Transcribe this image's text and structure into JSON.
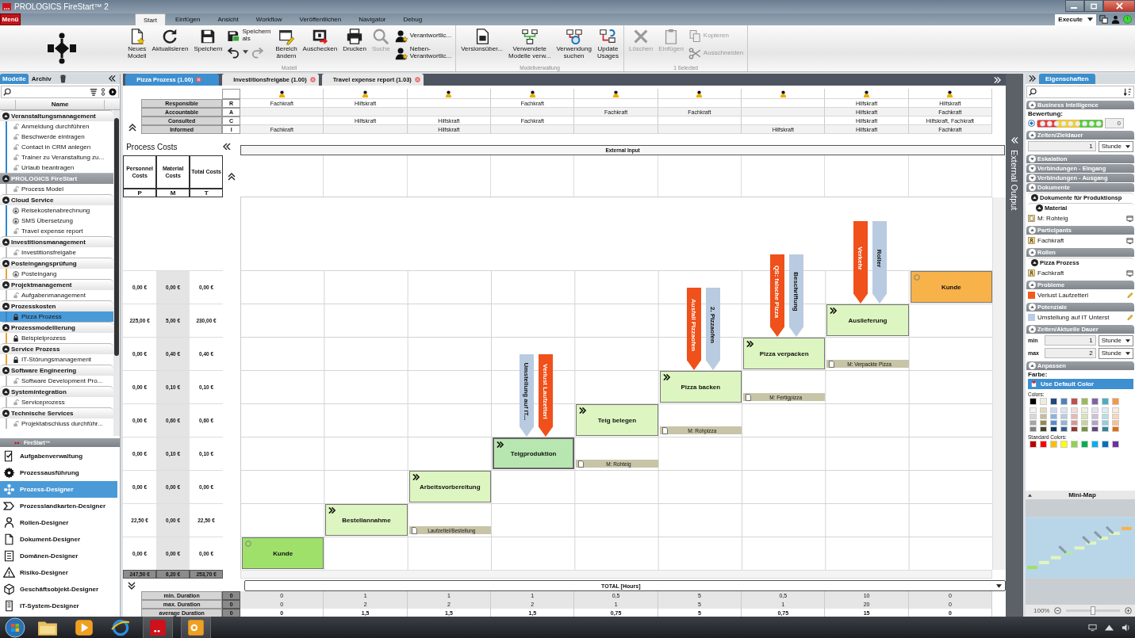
{
  "app": {
    "title": "PROLOGICS FireStart™ 2",
    "menu": "Menü",
    "mode": "Execute"
  },
  "ribbon": {
    "tabs": [
      {
        "label": "Start",
        "selected": true
      },
      {
        "label": "Einfügen",
        "selected": false
      },
      {
        "label": "Ansicht",
        "selected": false
      },
      {
        "label": "Workflow",
        "selected": false
      },
      {
        "label": "Veröffentlichen",
        "selected": false
      },
      {
        "label": "Navigator",
        "selected": false
      },
      {
        "label": "Debug",
        "selected": false
      }
    ],
    "groups": [
      {
        "label": "Modell",
        "items": [
          {
            "kind": "large",
            "label": "Neues\nModell",
            "disabled": false
          },
          {
            "kind": "large",
            "label": "Aktualisieren",
            "disabled": false
          },
          {
            "kind": "large",
            "label": "Speichern",
            "disabled": false
          },
          {
            "kind": "stack",
            "items": [
              {
                "kind": "small",
                "label": "Speichern\nals",
                "disabled": false
              },
              {
                "kind": "history",
                "disabled": false
              }
            ]
          },
          {
            "kind": "large",
            "label": "Bereich\nändern",
            "disabled": false
          },
          {
            "kind": "large",
            "label": "Auschecken",
            "disabled": false
          },
          {
            "kind": "large",
            "label": "Drucken",
            "disabled": false
          },
          {
            "kind": "large",
            "label": "Suche",
            "disabled": true
          },
          {
            "kind": "stack",
            "items": [
              {
                "kind": "small",
                "label": "Verantwortlic...",
                "disabled": false
              },
              {
                "kind": "small",
                "label": "Neben-\nVerantwortlic...",
                "disabled": false
              }
            ]
          }
        ]
      },
      {
        "label": "Modellverwaltung",
        "items": [
          {
            "kind": "large",
            "label": "Versionsüber...",
            "disabled": false
          },
          {
            "kind": "large",
            "label": "Verwendete\nModelle verw...",
            "disabled": false
          },
          {
            "kind": "large",
            "label": "Verwendung\nsuchen",
            "disabled": false
          },
          {
            "kind": "large",
            "label": "Update\nUsages",
            "disabled": false
          }
        ]
      },
      {
        "label": "1 Selected",
        "items": [
          {
            "kind": "large",
            "label": "Löschen",
            "disabled": true
          },
          {
            "kind": "large",
            "label": "Einfügen",
            "disabled": true
          },
          {
            "kind": "stack",
            "items": [
              {
                "kind": "small",
                "label": "Kopieren",
                "disabled": true
              },
              {
                "kind": "small",
                "label": "Ausschneiden",
                "disabled": true
              }
            ]
          }
        ]
      }
    ]
  },
  "models": {
    "tabs": [
      {
        "label": "Modelle",
        "selected": true
      },
      {
        "label": "Archiv",
        "selected": false
      }
    ],
    "column": "Name",
    "tree": [
      {
        "kind": "group",
        "label": "Veranstaltungsmanagement",
        "expanded": true,
        "children": [
          {
            "kind": "unlocked",
            "label": "Anmeldung durchführen",
            "color": "#2a8ad0",
            "selected": false
          },
          {
            "kind": "unlocked",
            "label": "Beschwerde eintragen",
            "color": "#2a8ad0",
            "selected": false
          },
          {
            "kind": "unlocked",
            "label": "Contact in CRM anlegen",
            "color": "#2a8ad0",
            "selected": false
          },
          {
            "kind": "unlocked",
            "label": "Trainer zu Veranstaltung zu...",
            "color": "#2a8ad0",
            "selected": false
          },
          {
            "kind": "unlocked",
            "label": "Urlaub beantragen",
            "color": "#2a8ad0",
            "selected": false
          }
        ]
      },
      {
        "kind": "root",
        "label": "PROLOGICS FireStart",
        "expanded": true,
        "children": [
          {
            "kind": "unlocked",
            "label": "Process Model",
            "color": "#c0c0c0",
            "selected": false
          }
        ]
      },
      {
        "kind": "group",
        "label": "Cloud Service",
        "expanded": true,
        "children": [
          {
            "kind": "checked-out",
            "label": "Reisekostenabrechnung",
            "color": "#2a8ad0",
            "selected": false
          },
          {
            "kind": "checked-out",
            "label": "SMS Übersetzung",
            "color": "#2a8ad0",
            "selected": false
          },
          {
            "kind": "unlocked",
            "label": "Travel expense report",
            "color": "#2a8ad0",
            "selected": false
          }
        ]
      },
      {
        "kind": "group",
        "label": "Investitionsmanagement",
        "expanded": true,
        "children": [
          {
            "kind": "unlocked",
            "label": "Investitionsfreigabe",
            "color": "#c0c0c0",
            "selected": false
          }
        ]
      },
      {
        "kind": "group",
        "label": "Posteingangsprüfung",
        "expanded": true,
        "children": [
          {
            "kind": "checked-out",
            "label": "Posteingang",
            "color": "#f0a030",
            "selected": false
          }
        ]
      },
      {
        "kind": "group",
        "label": "Projektmanagement",
        "expanded": true,
        "children": [
          {
            "kind": "unlocked",
            "label": "Aufgabenmanagement",
            "color": "#c0c0c0",
            "selected": false
          }
        ]
      },
      {
        "kind": "group",
        "label": "Prozesskosten",
        "expanded": true,
        "children": [
          {
            "kind": "locked",
            "label": "Pizza Prozess",
            "color": "#2a8ad0",
            "selected": true
          }
        ]
      },
      {
        "kind": "group",
        "label": "Prozessmodellierung",
        "expanded": true,
        "children": [
          {
            "kind": "locked",
            "label": "Beispielprozess",
            "color": "#f0a030",
            "selected": false
          }
        ]
      },
      {
        "kind": "group",
        "label": "Service Prozess",
        "expanded": true,
        "children": [
          {
            "kind": "locked",
            "label": "IT-Störungsmanagement",
            "color": "#f0a030",
            "selected": false
          }
        ]
      },
      {
        "kind": "group",
        "label": "Software Engineering",
        "expanded": true,
        "children": [
          {
            "kind": "unlocked",
            "label": "Software Development Pro...",
            "color": "#c0c0c0",
            "selected": false
          }
        ]
      },
      {
        "kind": "group",
        "label": "Systemintegration",
        "expanded": true,
        "children": [
          {
            "kind": "unlocked",
            "label": "Serviceprozess",
            "color": "#c0c0c0",
            "selected": false
          }
        ]
      },
      {
        "kind": "group",
        "label": "Technische Services",
        "expanded": true,
        "children": [
          {
            "kind": "unlocked",
            "label": "Projektabschluss durchführ...",
            "color": "#c0c0c0",
            "selected": false
          }
        ]
      }
    ],
    "nav_title": "FireStart™",
    "nav": [
      {
        "label": "Aufgabenverwaltung",
        "selected": false
      },
      {
        "label": "Prozessausführung",
        "selected": false
      },
      {
        "label": "Prozess-Designer",
        "selected": true
      },
      {
        "label": "Prozesslandkarten-Designer",
        "selected": false
      },
      {
        "label": "Rollen-Designer",
        "selected": false
      },
      {
        "label": "Dokument-Designer",
        "selected": false
      },
      {
        "label": "Domänen-Designer",
        "selected": false
      },
      {
        "label": "Risiko-Designer",
        "selected": false
      },
      {
        "label": "Geschäftsobjekt-Designer",
        "selected": false
      },
      {
        "label": "IT-System-Designer",
        "selected": false
      }
    ]
  },
  "center": {
    "doc_tabs": [
      {
        "label": "Pizza Prozess (1.00)",
        "selected": true
      },
      {
        "label": "Investitionsfreigabe (1.00)",
        "selected": false
      },
      {
        "label": "Travel expense report (1.03)",
        "selected": false
      }
    ],
    "raci_roles": [
      {
        "label": "Responsible",
        "letter": "R"
      },
      {
        "label": "Accountable",
        "letter": "A"
      },
      {
        "label": "Consulted",
        "letter": "C"
      },
      {
        "label": "Informed",
        "letter": "I"
      }
    ],
    "costs": {
      "title": "Process Costs",
      "columns": [
        {
          "label": "Personnel Costs",
          "letter": "P"
        },
        {
          "label": "Material Costs",
          "letter": "M"
        },
        {
          "label": "Total Costs",
          "letter": "T"
        }
      ],
      "totals": [
        "247,50 €",
        "6,20 €",
        "253,70 €"
      ]
    },
    "external_input": "External Input",
    "external_output": "External Output",
    "steps": [
      {
        "kind": "start",
        "label": "Kunde",
        "selected": false,
        "raci": {
          "responsible": "Fachkraft",
          "informed": "Fachkraft"
        },
        "costs": [
          "0,00 €",
          "0,00 €",
          "0,00 €"
        ],
        "durations": [
          "0",
          "0",
          "0"
        ]
      },
      {
        "kind": "task",
        "label": "Bestellannahme",
        "selected": false,
        "raci": {
          "responsible": "Hilfskraft",
          "consulted": "Hilfskraft"
        },
        "costs": [
          "22,50 €",
          "0,00 €",
          "22,50 €"
        ],
        "durations": [
          "1",
          "2",
          "1,5"
        ]
      },
      {
        "kind": "task",
        "label": "Arbeitsvorbereitung",
        "selected": false,
        "material": "Laufzettel/Bestellung",
        "raci": {
          "consulted": "Hilfskraft",
          "informed": "Hilfskraft"
        },
        "costs": [
          "0,00 €",
          "0,00 €",
          "0,00 €"
        ],
        "durations": [
          "1",
          "2",
          "1,5"
        ]
      },
      {
        "kind": "task",
        "label": "Teigproduktion",
        "selected": true,
        "raci": {
          "responsible": "Fachkraft",
          "consulted": "Fachkraft"
        },
        "costs": [
          "0,00 €",
          "0,10 €",
          "0,10 €"
        ],
        "durations": [
          "1",
          "2",
          "1,5"
        ],
        "flags": [
          {
            "kind": "potential",
            "label": "Umstellung auf IT..."
          },
          {
            "kind": "problem",
            "label": "Verlust Laufzetterl"
          }
        ]
      },
      {
        "kind": "task",
        "label": "Teig belegen",
        "selected": false,
        "material": "M: Rohteig",
        "raci": {
          "accountable": "Fachkraft"
        },
        "costs": [
          "0,00 €",
          "0,60 €",
          "0,60 €"
        ],
        "durations": [
          "0,5",
          "1",
          "0,75"
        ]
      },
      {
        "kind": "task",
        "label": "Pizza backen",
        "selected": false,
        "material": "M: Rohpizza",
        "raci": {
          "accountable": "Fachkraft"
        },
        "costs": [
          "0,00 €",
          "0,10 €",
          "0,10 €"
        ],
        "durations": [
          "5",
          "5",
          "5"
        ],
        "flags": [
          {
            "kind": "problem",
            "label": "Ausfall Pizzaofen"
          },
          {
            "kind": "potential",
            "label": "2. Pizzaofen"
          }
        ]
      },
      {
        "kind": "task",
        "label": "Pizza verpacken",
        "selected": false,
        "material": "M: Fertigpizza",
        "raci": {
          "informed": "Hilfskraft"
        },
        "costs": [
          "0,00 €",
          "0,40 €",
          "0,40 €"
        ],
        "durations": [
          "0,5",
          "1",
          "0,75"
        ],
        "flags": [
          {
            "kind": "problem",
            "label": "QS: falsche Pizza"
          },
          {
            "kind": "potential",
            "label": "Beschriftung"
          }
        ]
      },
      {
        "kind": "task",
        "label": "Auslieferung",
        "selected": false,
        "material": "M: Verpackte Pizza",
        "raci": {
          "responsible": "Hilfskraft",
          "accountable": "Hilfskraft",
          "consulted": "Hilfskraft",
          "informed": "Hilfskraft"
        },
        "costs": [
          "225,00 €",
          "5,00 €",
          "230,00 €"
        ],
        "durations": [
          "10",
          "20",
          "15"
        ],
        "flags": [
          {
            "kind": "problem",
            "label": "Verkehr"
          },
          {
            "kind": "potential",
            "label": "Roller"
          }
        ]
      },
      {
        "kind": "end",
        "label": "Kunde",
        "selected": false,
        "raci": {
          "responsible": "Hilfskraft",
          "accountable": "Fachkraft",
          "consulted": "Hilfskraft, Fachkraft",
          "informed": "Fachkraft"
        },
        "costs": [
          "0,00 €",
          "0,00 €",
          "0,00 €"
        ],
        "durations": [
          "0",
          "0",
          "0"
        ]
      }
    ],
    "durations": {
      "title": "TOTAL [Hours]",
      "rows": [
        {
          "kind": "value",
          "label": "min. Duration",
          "badge": "0"
        },
        {
          "kind": "value",
          "label": "max. Duration",
          "badge": "0"
        },
        {
          "kind": "summary",
          "label": "average Duration",
          "badge": "0"
        }
      ]
    }
  },
  "properties": {
    "tab": "Eigenschaften",
    "sections": [
      {
        "title": "Business Intelligence",
        "expanded": true,
        "kind": "rating",
        "label": "Bewertung:",
        "checked": true,
        "value": "0"
      },
      {
        "title": "Zeiten/Zieldauer",
        "expanded": true,
        "kind": "durations",
        "rows": [
          {
            "value": "1",
            "unit": "Stunde"
          }
        ]
      },
      {
        "title": "Eskalation",
        "expanded": false
      },
      {
        "title": "Verbindungen - Eingang",
        "expanded": false
      },
      {
        "title": "Verbindungen - Ausgang",
        "expanded": false
      },
      {
        "title": "Dokumente",
        "expanded": true,
        "kind": "nested",
        "subtitle": "Dokumente für Produktionsp",
        "subsubtitle": "Material",
        "items": [
          {
            "kind": "document",
            "label": "M: Rohteig"
          }
        ]
      },
      {
        "title": "Participants",
        "expanded": true,
        "kind": "list",
        "items": [
          {
            "kind": "role",
            "label": "Fachkraft"
          }
        ]
      },
      {
        "title": "Rollen",
        "expanded": true,
        "kind": "nested",
        "subtitle": "Pizza Prozess",
        "items": [
          {
            "kind": "role",
            "label": "Fachkraft"
          }
        ]
      },
      {
        "title": "Probleme",
        "expanded": true,
        "kind": "list",
        "items": [
          {
            "kind": "problem",
            "label": "Verlust Laufzetterl",
            "color": "#f25a1c"
          }
        ]
      },
      {
        "title": "Potenziale",
        "expanded": true,
        "kind": "list",
        "items": [
          {
            "kind": "potential",
            "label": "Umstellung auf IT Unterst",
            "color": "#b8cce4"
          }
        ]
      },
      {
        "title": "Zeiten/Aktuelle Dauer",
        "expanded": true,
        "kind": "durations",
        "rows": [
          {
            "label": "min",
            "value": "1",
            "unit": "Stunde"
          },
          {
            "label": "max",
            "value": "2",
            "unit": "Stunde"
          }
        ]
      },
      {
        "title": "Anpassen",
        "expanded": true,
        "kind": "colors",
        "label": "Farbe:",
        "button": "Use Default Color",
        "colors_label": "Colors:",
        "standard_label": "Standard Colors:",
        "theme": [
          {
            "color": "#000000"
          },
          {
            "color": "#eeece1"
          },
          {
            "color": "#1f497d"
          },
          {
            "color": "#4f81bd"
          },
          {
            "color": "#c0504d"
          },
          {
            "color": "#9bbb59"
          },
          {
            "color": "#8064a2"
          },
          {
            "color": "#4bacc6"
          },
          {
            "color": "#f79646"
          },
          {
            "color": "#f2f2f2"
          },
          {
            "color": "#ddd9c3"
          },
          {
            "color": "#c6d9f0"
          },
          {
            "color": "#dbe5f1"
          },
          {
            "color": "#f2dcdb"
          },
          {
            "color": "#ebf1dd"
          },
          {
            "color": "#e5e0ec"
          },
          {
            "color": "#dbeef3"
          },
          {
            "color": "#fdeada"
          },
          {
            "color": "#d8d8d8"
          },
          {
            "color": "#c4bd97"
          },
          {
            "color": "#8db3e2"
          },
          {
            "color": "#b8cce4"
          },
          {
            "color": "#e5b9b7"
          },
          {
            "color": "#d7e3bc"
          },
          {
            "color": "#ccc1d9"
          },
          {
            "color": "#b7dde8"
          },
          {
            "color": "#fbd5b5"
          },
          {
            "color": "#a5a5a5"
          },
          {
            "color": "#938953"
          },
          {
            "color": "#548dd4"
          },
          {
            "color": "#95b3d7"
          },
          {
            "color": "#d99694"
          },
          {
            "color": "#c3d69b"
          },
          {
            "color": "#b2a2c7"
          },
          {
            "color": "#92cddc"
          },
          {
            "color": "#fac08f"
          },
          {
            "color": "#7f7f7f"
          },
          {
            "color": "#494429"
          },
          {
            "color": "#17365d"
          },
          {
            "color": "#366092"
          },
          {
            "color": "#953734"
          },
          {
            "color": "#76923c"
          },
          {
            "color": "#5f497a"
          },
          {
            "color": "#31859b"
          },
          {
            "color": "#e36c09"
          }
        ],
        "standard": [
          {
            "color": "#c00000"
          },
          {
            "color": "#ff0000"
          },
          {
            "color": "#ffc000"
          },
          {
            "color": "#ffff00"
          },
          {
            "color": "#92d050"
          },
          {
            "color": "#00b050"
          },
          {
            "color": "#00b0f0"
          },
          {
            "color": "#0070c0"
          },
          {
            "color": "#7030a0"
          }
        ]
      }
    ],
    "minimap": {
      "title": "Mini-Map",
      "zoom": "100%",
      "level": 0.5
    }
  }
}
